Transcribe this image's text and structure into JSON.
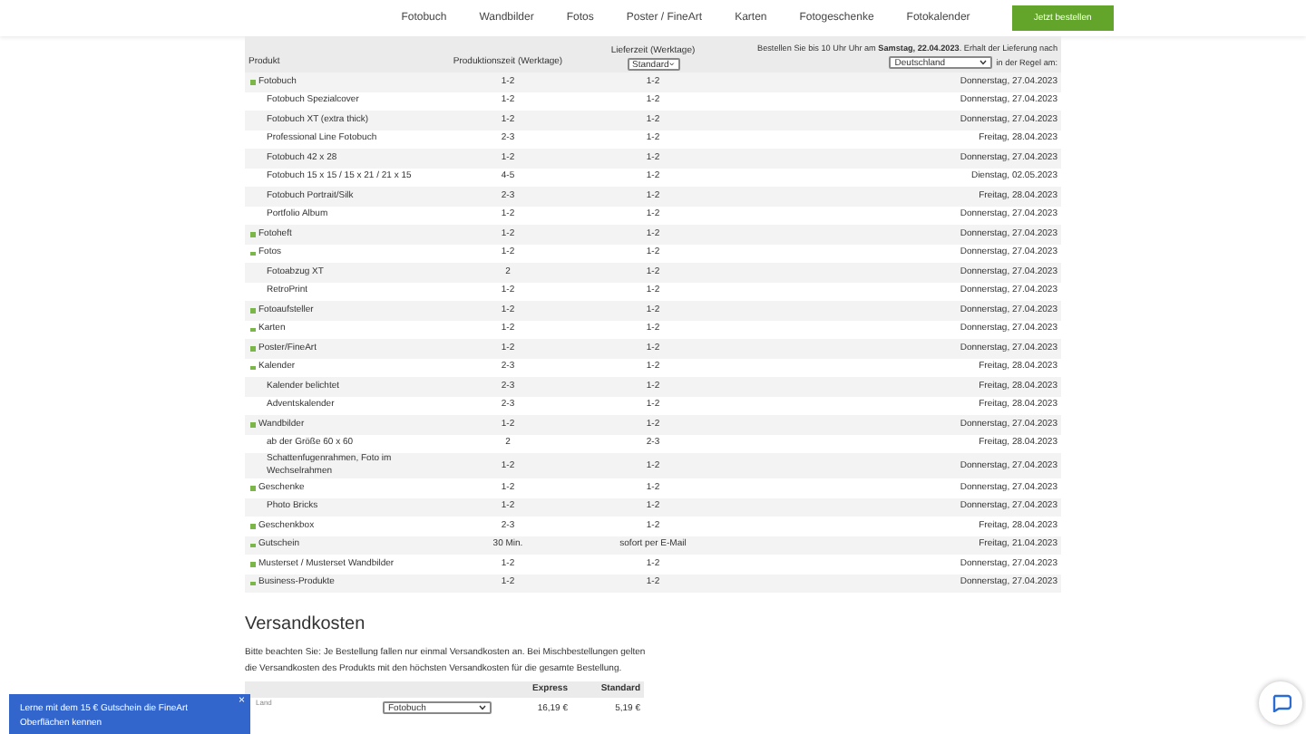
{
  "nav": {
    "items": [
      "Fotobuch",
      "Wandbilder",
      "Fotos",
      "Poster / FineArt",
      "Karten",
      "Fotogeschenke",
      "Fotokalender"
    ],
    "cta": "Jetzt bestellen"
  },
  "table": {
    "columns": {
      "product": "Produkt",
      "production": "Produktionszeit (Werktage)",
      "delivery_label": "Lieferzeit (Werktage)",
      "delivery_select": "Standard",
      "order_note": "Bestellen Sie bis 10 Uhr Uhr am **Samstag, 22.04.2023**. Erhalt der Lieferung nach",
      "country_select": "Deutschland",
      "date_suffix": "in der Regel am:"
    },
    "rows": [
      {
        "name": "Fotobuch",
        "production": "1-2",
        "delivery": "1-2",
        "date": "Donnerstag, 27.04.2023",
        "children": [
          {
            "name": "Fotobuch Spezialcover",
            "production": "1-2",
            "delivery": "1-2",
            "date": "Donnerstag, 27.04.2023"
          },
          {
            "name": "Fotobuch XT (extra thick)",
            "production": "1-2",
            "delivery": "1-2",
            "date": "Donnerstag, 27.04.2023"
          },
          {
            "name": "Professional Line Fotobuch",
            "production": "2-3",
            "delivery": "1-2",
            "date": "Freitag, 28.04.2023"
          },
          {
            "name": "Fotobuch 42 x 28",
            "production": "1-2",
            "delivery": "1-2",
            "date": "Donnerstag, 27.04.2023"
          },
          {
            "name": "Fotobuch 15 x 15 / 15 x 21 / 21 x 15",
            "production": "4-5",
            "delivery": "1-2",
            "date": "Dienstag, 02.05.2023"
          },
          {
            "name": "Fotobuch Portrait/Silk",
            "production": "2-3",
            "delivery": "1-2",
            "date": "Freitag, 28.04.2023"
          },
          {
            "name": "Portfolio Album",
            "production": "1-2",
            "delivery": "1-2",
            "date": "Donnerstag, 27.04.2023"
          }
        ]
      },
      {
        "name": "Fotoheft",
        "production": "1-2",
        "delivery": "1-2",
        "date": "Donnerstag, 27.04.2023"
      },
      {
        "name": "Fotos",
        "production": "1-2",
        "delivery": "1-2",
        "date": "Donnerstag, 27.04.2023",
        "children": [
          {
            "name": "Fotoabzug XT",
            "production": "2",
            "delivery": "1-2",
            "date": "Donnerstag, 27.04.2023"
          },
          {
            "name": "RetroPrint",
            "production": "1-2",
            "delivery": "1-2",
            "date": "Donnerstag, 27.04.2023"
          }
        ]
      },
      {
        "name": "Fotoaufsteller",
        "production": "1-2",
        "delivery": "1-2",
        "date": "Donnerstag, 27.04.2023"
      },
      {
        "name": "Karten",
        "production": "1-2",
        "delivery": "1-2",
        "date": "Donnerstag, 27.04.2023"
      },
      {
        "name": "Poster/FineArt",
        "production": "1-2",
        "delivery": "1-2",
        "date": "Donnerstag, 27.04.2023"
      },
      {
        "name": "Kalender",
        "production": "2-3",
        "delivery": "1-2",
        "date": "Freitag, 28.04.2023",
        "children": [
          {
            "name": "Kalender belichtet",
            "production": "2-3",
            "delivery": "1-2",
            "date": "Freitag, 28.04.2023"
          },
          {
            "name": "Adventskalender",
            "production": "2-3",
            "delivery": "1-2",
            "date": "Freitag, 28.04.2023"
          }
        ]
      },
      {
        "name": "Wandbilder",
        "production": "1-2",
        "delivery": "1-2",
        "date": "Donnerstag, 27.04.2023",
        "children": [
          {
            "name": "ab der Größe 60 x 60",
            "production": "2",
            "delivery": "2-3",
            "date": "Freitag, 28.04.2023"
          },
          {
            "name": "Schattenfugenrahmen, Foto im Wechselrahmen",
            "production": "1-2",
            "delivery": "1-2",
            "date": "Donnerstag, 27.04.2023"
          }
        ]
      },
      {
        "name": "Geschenke",
        "production": "1-2",
        "delivery": "1-2",
        "date": "Donnerstag, 27.04.2023",
        "children": [
          {
            "name": "Photo Bricks",
            "production": "1-2",
            "delivery": "1-2",
            "date": "Donnerstag, 27.04.2023"
          }
        ]
      },
      {
        "name": "Geschenkbox",
        "production": "2-3",
        "delivery": "1-2",
        "date": "Freitag, 28.04.2023"
      },
      {
        "name": "Gutschein",
        "production": "30 Min.",
        "delivery": "sofort per E-Mail",
        "date": "Freitag, 21.04.2023"
      },
      {
        "name": "Musterset / Musterset Wandbilder",
        "production": "1-2",
        "delivery": "1-2",
        "date": "Donnerstag, 27.04.2023"
      },
      {
        "name": "Business-Produkte",
        "production": "1-2",
        "delivery": "1-2",
        "date": "Donnerstag, 27.04.2023"
      }
    ]
  },
  "shipping": {
    "title": "Versandkosten",
    "note": "Bitte beachten Sie: Je Bestellung fallen nur einmal Versandkosten an. Bei Mischbestellungen gelten die Versandkosten des Produkts mit den höchsten Versandkosten für die gesamte Bestellung.",
    "columns": [
      "Express",
      "Standard"
    ],
    "country_label": "Land",
    "product_select": "Fotobuch",
    "express": "16,19 €",
    "standard": "5,19 €"
  },
  "banner": {
    "text": "Lerne mit dem 15 € Gutschein die FineArt Oberflächen kennen",
    "close": "×"
  }
}
